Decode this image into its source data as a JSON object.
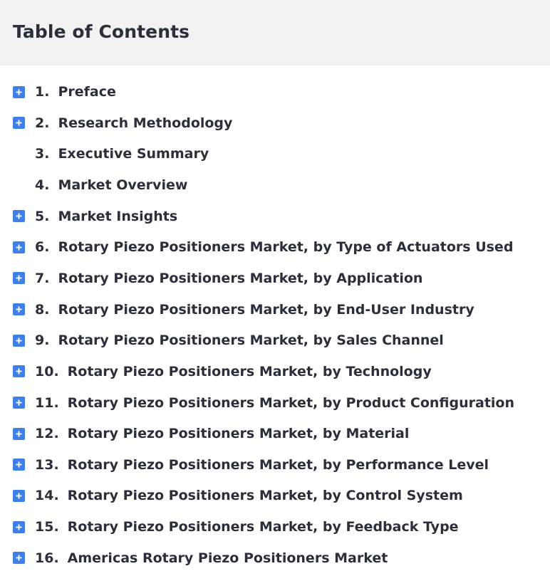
{
  "header": {
    "title": "Table of Contents"
  },
  "toc": {
    "items": [
      {
        "num": "1.",
        "label": "Preface",
        "expandable": true
      },
      {
        "num": "2.",
        "label": "Research Methodology",
        "expandable": true
      },
      {
        "num": "3.",
        "label": "Executive Summary",
        "expandable": false
      },
      {
        "num": "4.",
        "label": "Market Overview",
        "expandable": false
      },
      {
        "num": "5.",
        "label": "Market Insights",
        "expandable": true
      },
      {
        "num": "6.",
        "label": "Rotary Piezo Positioners Market, by Type of Actuators Used",
        "expandable": true
      },
      {
        "num": "7.",
        "label": "Rotary Piezo Positioners Market, by Application",
        "expandable": true
      },
      {
        "num": "8.",
        "label": "Rotary Piezo Positioners Market, by End-User Industry",
        "expandable": true
      },
      {
        "num": "9.",
        "label": "Rotary Piezo Positioners Market, by Sales Channel",
        "expandable": true
      },
      {
        "num": "10.",
        "label": "Rotary Piezo Positioners Market, by Technology",
        "expandable": true
      },
      {
        "num": "11.",
        "label": "Rotary Piezo Positioners Market, by Product Configuration",
        "expandable": true
      },
      {
        "num": "12.",
        "label": "Rotary Piezo Positioners Market, by Material",
        "expandable": true
      },
      {
        "num": "13.",
        "label": "Rotary Piezo Positioners Market, by Performance Level",
        "expandable": true
      },
      {
        "num": "14.",
        "label": "Rotary Piezo Positioners Market, by Control System",
        "expandable": true
      },
      {
        "num": "15.",
        "label": "Rotary Piezo Positioners Market, by Feedback Type",
        "expandable": true
      },
      {
        "num": "16.",
        "label": "Americas Rotary Piezo Positioners Market",
        "expandable": true
      }
    ]
  },
  "icons": {
    "expand": "plus-square-icon"
  },
  "colors": {
    "accent": "#3f80e6",
    "header_bg": "#f2f2f2",
    "text": "#2b2f3a"
  }
}
